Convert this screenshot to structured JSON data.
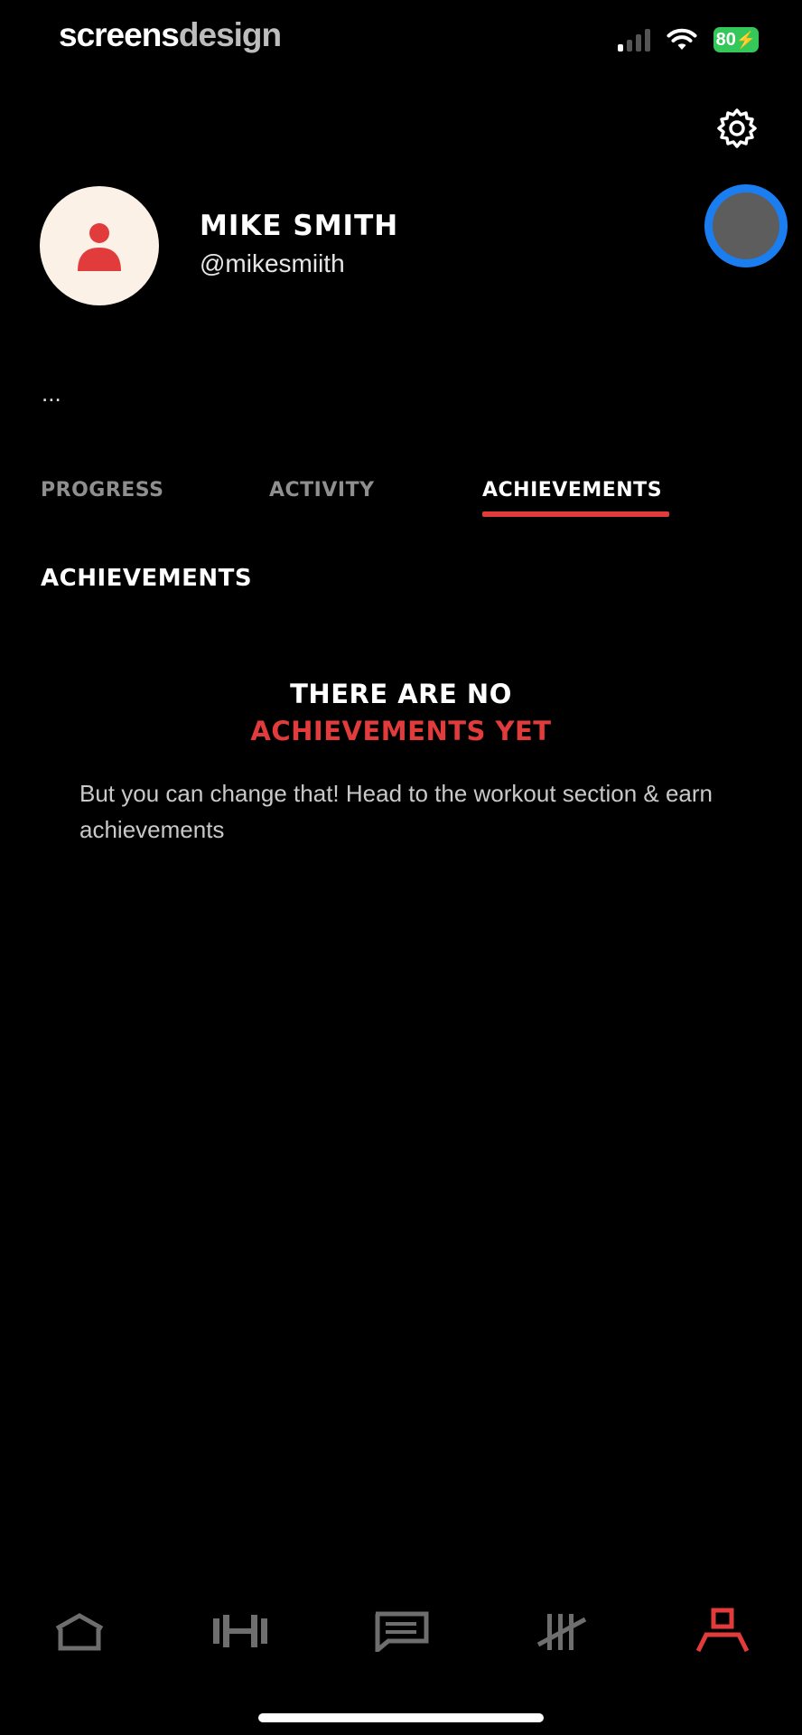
{
  "status_bar": {
    "brand_part1": "screens",
    "brand_part2": "design",
    "battery": "80"
  },
  "profile": {
    "name": "MIKE SMITH",
    "handle": "@mikesmiith",
    "bio": "..."
  },
  "tabs": [
    {
      "label": "PROGRESS",
      "active": false
    },
    {
      "label": "ACTIVITY",
      "active": false
    },
    {
      "label": "ACHIEVEMENTS",
      "active": true
    }
  ],
  "section": {
    "title": "ACHIEVEMENTS"
  },
  "empty_state": {
    "line1": "THERE ARE NO",
    "line2": "ACHIEVEMENTS YET",
    "body": "But you can change that! Head to the workout section & earn achievements"
  },
  "bottom_nav": [
    {
      "icon": "home-icon",
      "active": false
    },
    {
      "icon": "dumbbell-icon",
      "active": false
    },
    {
      "icon": "chat-icon",
      "active": false
    },
    {
      "icon": "tally-icon",
      "active": false
    },
    {
      "icon": "profile-icon",
      "active": true
    }
  ],
  "colors": {
    "accent": "#e23b3b",
    "toggle_ring": "#1a7ef0",
    "battery": "#34c759",
    "avatar_bg": "#fbf1e6",
    "inactive_icon": "#6e6e6e"
  }
}
